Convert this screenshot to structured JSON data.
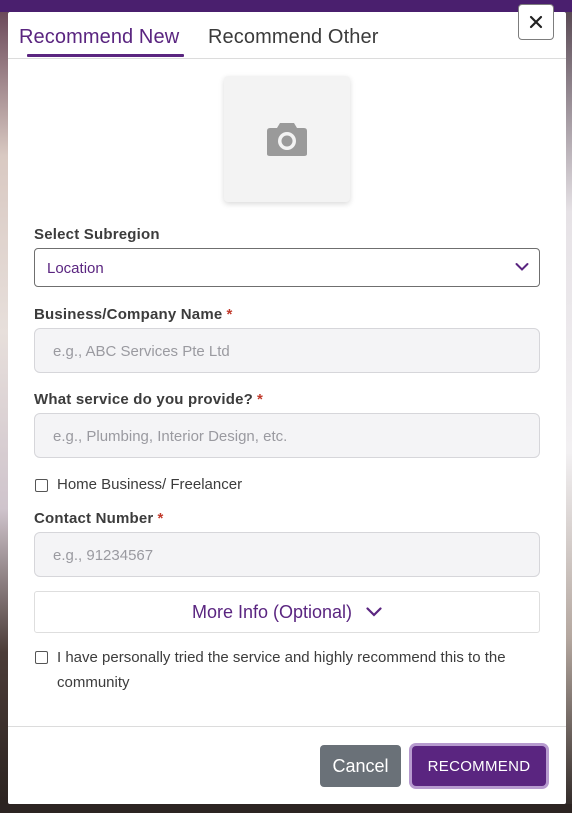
{
  "tabs": {
    "new_label": "Recommend New",
    "other_label": "Recommend Other"
  },
  "close": {
    "icon": "close-icon",
    "glyph": "✕"
  },
  "photo": {
    "icon": "camera-icon"
  },
  "subregion": {
    "label": "Select Subregion",
    "value": "Location"
  },
  "business": {
    "label": "Business/Company Name",
    "required_mark": "*",
    "placeholder": "e.g., ABC Services Pte Ltd"
  },
  "service": {
    "label": "What service do you provide?",
    "required_mark": "*",
    "placeholder": "e.g., Plumbing, Interior Design, etc."
  },
  "home_business": {
    "label": "Home Business/ Freelancer"
  },
  "contact": {
    "label": "Contact Number",
    "required_mark": "*",
    "placeholder": "e.g., 91234567"
  },
  "more_info": {
    "label": "More Info (Optional)"
  },
  "agree": {
    "label": "I have personally tried the service and highly recommend this to the community"
  },
  "footer": {
    "cancel_label": "Cancel",
    "recommend_label": "RECOMMEND"
  },
  "colors": {
    "accent": "#5a2580",
    "cancel": "#6a7178",
    "required": "#c0392b",
    "placeholder": "#9a9aa0"
  }
}
